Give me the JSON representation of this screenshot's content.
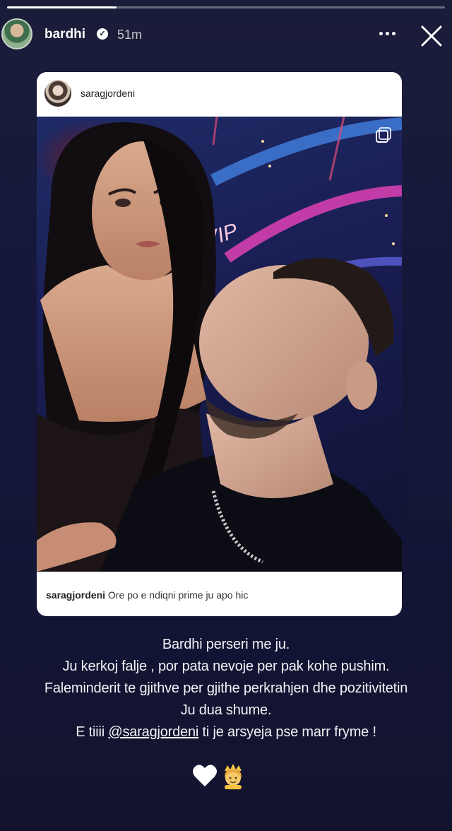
{
  "story": {
    "progress": 0.25,
    "username": "bardhi",
    "verified": true,
    "timestamp": "51m"
  },
  "shared_post": {
    "username": "saragjordeni",
    "caption_user": "saragjordeni",
    "caption_text": "Ore po e ndiqni prime ju apo hic",
    "photo_sign": "VIP"
  },
  "caption": {
    "line1": "Bardhi perseri me ju.",
    "line2": "Ju kerkoj falje , por pata nevoje per pak kohe pushim.",
    "line3": "Faleminderit te gjithve per gjithe perkrahjen dhe pozitivitetin",
    "line4": "Ju dua shume.",
    "line5_before": "E tiiii ",
    "line5_mention": "@saragjordeni",
    "line5_after": " ti je arsyeja pse marr fryme !"
  },
  "icons": {
    "verified": "verified-badge-icon",
    "more": "more-horizontal-icon",
    "close": "close-icon",
    "multi_post": "multiple-posts-icon",
    "heart": "white-heart-icon",
    "princess": "princess-emoji-icon"
  }
}
